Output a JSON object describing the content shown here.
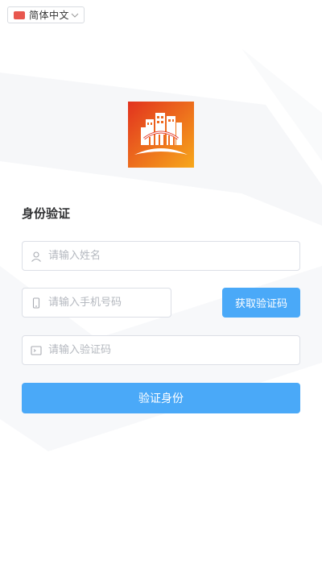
{
  "language": {
    "label": "简体中文",
    "flag_color": "#e8574e"
  },
  "logo": {
    "name": "building-logo",
    "gradient": [
      "#e2321f",
      "#f7a81b"
    ]
  },
  "form": {
    "title": "身份验证",
    "name_placeholder": "请输入姓名",
    "phone_placeholder": "请输入手机号码",
    "code_placeholder": "请输入验证码",
    "get_code_label": "获取验证码",
    "submit_label": "验证身份"
  },
  "colors": {
    "primary": "#4aa9f8",
    "border": "#dcdfe6",
    "placeholder": "#b4b8bf"
  }
}
